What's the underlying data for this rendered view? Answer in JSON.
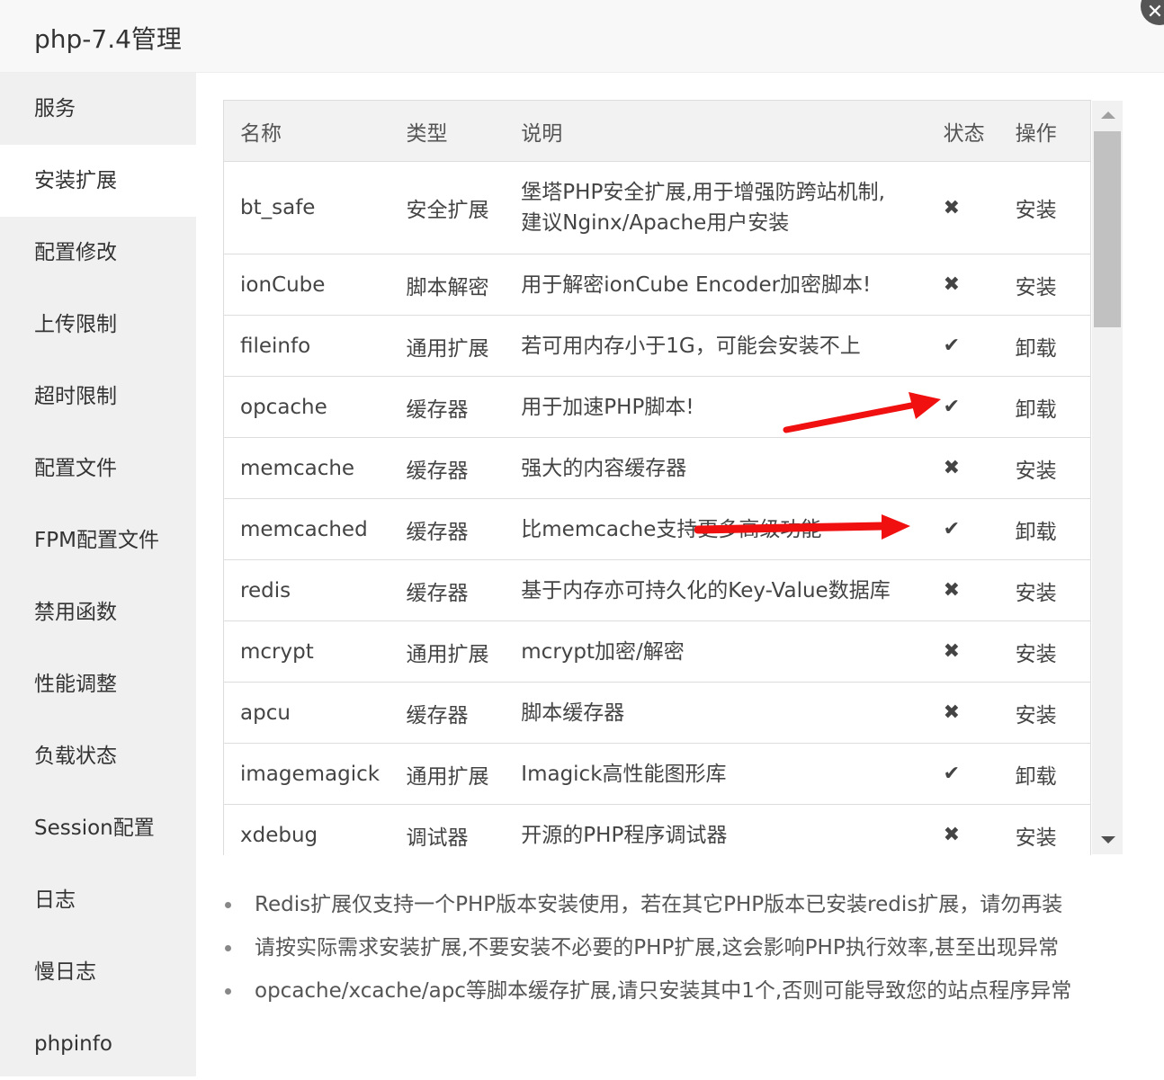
{
  "window": {
    "title": "php-7.4管理"
  },
  "sidebar": {
    "items": [
      {
        "label": "服务"
      },
      {
        "label": "安装扩展"
      },
      {
        "label": "配置修改"
      },
      {
        "label": "上传限制"
      },
      {
        "label": "超时限制"
      },
      {
        "label": "配置文件"
      },
      {
        "label": "FPM配置文件"
      },
      {
        "label": "禁用函数"
      },
      {
        "label": "性能调整"
      },
      {
        "label": "负载状态"
      },
      {
        "label": "Session配置"
      },
      {
        "label": "日志"
      },
      {
        "label": "慢日志"
      },
      {
        "label": "phpinfo"
      }
    ],
    "active_index": 1
  },
  "table": {
    "headers": {
      "name": "名称",
      "type": "类型",
      "desc": "说明",
      "status": "状态",
      "action": "操作"
    },
    "rows": [
      {
        "name": "bt_safe",
        "type": "安全扩展",
        "desc_line1": "堡塔PHP安全扩展,用于增强防跨站机制,",
        "desc_line2": "建议Nginx/Apache用户安装",
        "status": "✖",
        "installed": false,
        "action": "安装"
      },
      {
        "name": "ionCube",
        "type": "脚本解密",
        "desc": "用于解密ionCube Encoder加密脚本!",
        "status": "✖",
        "installed": false,
        "action": "安装"
      },
      {
        "name": "fileinfo",
        "type": "通用扩展",
        "desc": "若可用内存小于1G，可能会安装不上",
        "status": "✔",
        "installed": true,
        "action": "卸载"
      },
      {
        "name": "opcache",
        "type": "缓存器",
        "desc": "用于加速PHP脚本!",
        "status": "✔",
        "installed": true,
        "action": "卸载"
      },
      {
        "name": "memcache",
        "type": "缓存器",
        "desc": "强大的内容缓存器",
        "status": "✖",
        "installed": false,
        "action": "安装"
      },
      {
        "name": "memcached",
        "type": "缓存器",
        "desc": "比memcache支持更多高级功能",
        "status": "✔",
        "installed": true,
        "action": "卸载"
      },
      {
        "name": "redis",
        "type": "缓存器",
        "desc": "基于内存亦可持久化的Key-Value数据库",
        "status": "✖",
        "installed": false,
        "action": "安装"
      },
      {
        "name": "mcrypt",
        "type": "通用扩展",
        "desc": "mcrypt加密/解密",
        "status": "✖",
        "installed": false,
        "action": "安装"
      },
      {
        "name": "apcu",
        "type": "缓存器",
        "desc": "脚本缓存器",
        "status": "✖",
        "installed": false,
        "action": "安装"
      },
      {
        "name": "imagemagick",
        "type": "通用扩展",
        "desc": "Imagick高性能图形库",
        "status": "✔",
        "installed": true,
        "action": "卸载"
      },
      {
        "name": "xdebug",
        "type": "调试器",
        "desc": "开源的PHP程序调试器",
        "status": "✖",
        "installed": false,
        "action": "安装"
      }
    ]
  },
  "notes": [
    "Redis扩展仅支持一个PHP版本安装使用，若在其它PHP版本已安装redis扩展，请勿再装",
    "请按实际需求安装扩展,不要安装不必要的PHP扩展,这会影响PHP执行效率,甚至出现异常",
    "opcache/xcache/apc等脚本缓存扩展,请只安装其中1个,否则可能导致您的站点程序异常"
  ],
  "colors": {
    "install": "#20a53a",
    "uninstall": "#e02020",
    "annotation_arrow": "#f01010",
    "sidebar_bg": "#f0f0f0"
  },
  "icons": {
    "close": "close-icon",
    "installed": "check-icon",
    "not_installed": "cross-icon"
  }
}
